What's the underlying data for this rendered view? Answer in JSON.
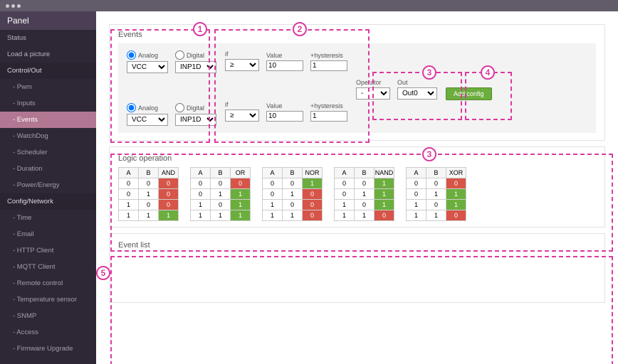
{
  "sidebar": {
    "header": "Panel",
    "items": [
      "Status",
      "Load a picture"
    ],
    "control_out": {
      "label": "Control/Out",
      "subs": [
        "- Pwm",
        "- Inputs",
        "- Events",
        "- WatchDog",
        "- Scheduler",
        "- Duration",
        "- Power/Energy"
      ]
    },
    "config_net": {
      "label": "Config/Network",
      "subs": [
        "- Time",
        "- Email",
        "- HTTP Client",
        "- MQTT Client",
        "- Remote control",
        "- Temperature sensor",
        "- SNMP",
        "- Access",
        "- Firmware Upgrade"
      ]
    },
    "active_sub": "- Events"
  },
  "events": {
    "title": "Events",
    "source": {
      "analog_label": "Analog",
      "digital_label": "Digital",
      "analog_selected": true,
      "analog_option": "VCC",
      "digital_option": "INP1D"
    },
    "cond": {
      "if_label": "if",
      "if_value": "≥",
      "value_label": "Value",
      "value": "10",
      "hyst_label": "+hysteresis",
      "hyst": "1"
    },
    "operator": {
      "label": "Operator",
      "value": "-"
    },
    "out": {
      "label": "Out",
      "value": "Out0"
    },
    "add_label": "Add config"
  },
  "logic": {
    "title": "Logic operation",
    "tables": [
      {
        "name": "AND",
        "rows": [
          [
            "0",
            "0",
            "0",
            "r"
          ],
          [
            "0",
            "1",
            "0",
            "r"
          ],
          [
            "1",
            "0",
            "0",
            "r"
          ],
          [
            "1",
            "1",
            "1",
            "g"
          ]
        ]
      },
      {
        "name": "OR",
        "rows": [
          [
            "0",
            "0",
            "0",
            "r"
          ],
          [
            "0",
            "1",
            "1",
            "g"
          ],
          [
            "1",
            "0",
            "1",
            "g"
          ],
          [
            "1",
            "1",
            "1",
            "g"
          ]
        ]
      },
      {
        "name": "NOR",
        "rows": [
          [
            "0",
            "0",
            "1",
            "g"
          ],
          [
            "0",
            "1",
            "0",
            "r"
          ],
          [
            "1",
            "0",
            "0",
            "r"
          ],
          [
            "1",
            "1",
            "0",
            "r"
          ]
        ]
      },
      {
        "name": "NAND",
        "rows": [
          [
            "0",
            "0",
            "1",
            "g"
          ],
          [
            "0",
            "1",
            "1",
            "g"
          ],
          [
            "1",
            "0",
            "1",
            "g"
          ],
          [
            "1",
            "1",
            "0",
            "r"
          ]
        ]
      },
      {
        "name": "XOR",
        "rows": [
          [
            "0",
            "0",
            "0",
            "r"
          ],
          [
            "0",
            "1",
            "1",
            "g"
          ],
          [
            "1",
            "0",
            "1",
            "g"
          ],
          [
            "1",
            "1",
            "0",
            "r"
          ]
        ]
      }
    ],
    "col_a": "A",
    "col_b": "B"
  },
  "eventlist": {
    "title": "Event list"
  },
  "callouts": {
    "1": "1",
    "2": "2",
    "3": "3",
    "4": "4",
    "5": "5"
  }
}
